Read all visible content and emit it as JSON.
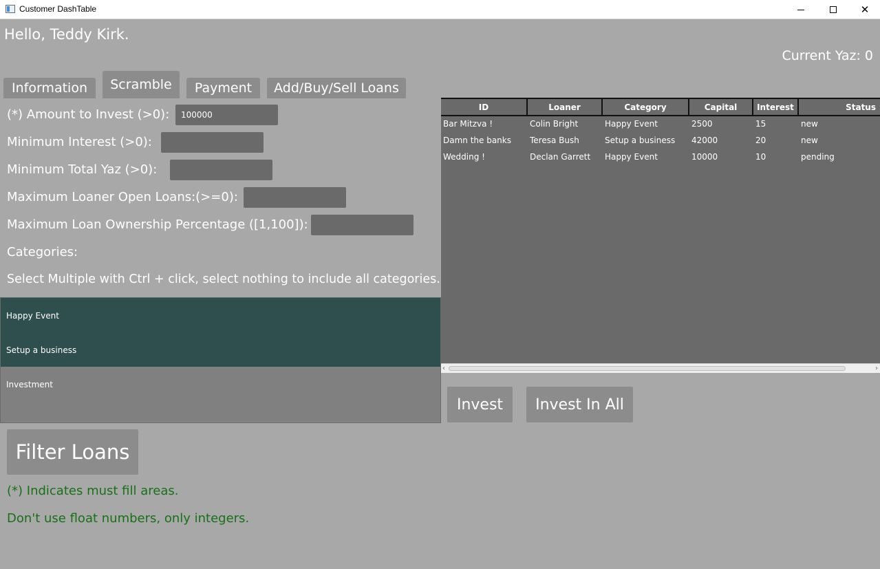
{
  "window": {
    "title": "Customer DashTable",
    "minimize_glyph": "minimize",
    "maximize_glyph": "maximize",
    "close_glyph": "✕"
  },
  "header": {
    "greeting": "Hello, Teddy Kirk.",
    "current_yaz": "Current Yaz: 0"
  },
  "tabs": [
    {
      "label": "Information",
      "active": false
    },
    {
      "label": "Scramble",
      "active": true
    },
    {
      "label": "Payment",
      "active": false
    },
    {
      "label": "Add/Buy/Sell Loans",
      "active": false
    }
  ],
  "form": {
    "amount_label": "(*) Amount to Invest (>0):",
    "amount_value": "100000",
    "min_interest_label": "Minimum Interest (>0):",
    "min_interest_value": "",
    "min_total_yaz_label": "Minimum Total Yaz (>0):",
    "min_total_yaz_value": "",
    "max_open_loans_label": "Maximum Loaner Open Loans:(>=0):",
    "max_open_loans_value": "",
    "max_ownership_label": "Maximum Loan Ownership Percentage ([1,100]):",
    "max_ownership_value": "",
    "categories_label": "Categories:",
    "categories_hint": "Select Multiple with Ctrl + click, select nothing to include all categories."
  },
  "categories": [
    {
      "label": "Happy Event",
      "selected": true
    },
    {
      "label": "Setup a business",
      "selected": true
    },
    {
      "label": "Investment",
      "selected": false
    }
  ],
  "filter_button": "Filter Loans",
  "notes": {
    "must_fill": "(*) Indicates must fill areas.",
    "integers": "Don't use float numbers, only integers."
  },
  "table": {
    "columns": [
      "ID",
      "Loaner",
      "Category",
      "Capital",
      "Interest",
      "Status"
    ],
    "rows": [
      [
        "Bar Mitzva !",
        "Colin Bright",
        "Happy Event",
        "2500",
        "15",
        "new"
      ],
      [
        "Damn the banks",
        "Teresa Bush",
        "Setup a business",
        "42000",
        "20",
        "new"
      ],
      [
        "Wedding !",
        "Declan Garrett",
        "Happy Event",
        "10000",
        "10",
        "pending"
      ]
    ]
  },
  "actions": {
    "invest": "Invest",
    "invest_all": "Invest In All"
  },
  "colors": {
    "background": "#a8a8a8",
    "selected_category": "#2f4f4f",
    "note_text": "#1a6e1a",
    "table_bg": "#6a6a6a"
  }
}
